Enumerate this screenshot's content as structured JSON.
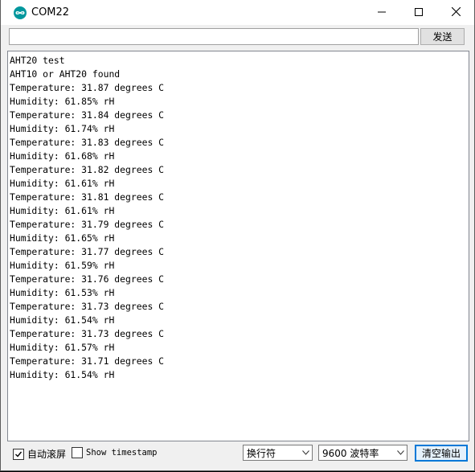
{
  "window": {
    "title": "COM22",
    "icon": "arduino-logo-icon",
    "controls": [
      "minimize-icon",
      "maximize-icon",
      "close-icon"
    ]
  },
  "send": {
    "input_value": "",
    "button_label": "发送"
  },
  "output": {
    "lines": [
      "AHT20 test",
      "AHT10 or AHT20 found",
      "Temperature: 31.87 degrees C",
      "Humidity: 61.85% rH",
      "Temperature: 31.84 degrees C",
      "Humidity: 61.74% rH",
      "Temperature: 31.83 degrees C",
      "Humidity: 61.68% rH",
      "Temperature: 31.82 degrees C",
      "Humidity: 61.61% rH",
      "Temperature: 31.81 degrees C",
      "Humidity: 61.61% rH",
      "Temperature: 31.79 degrees C",
      "Humidity: 61.65% rH",
      "Temperature: 31.77 degrees C",
      "Humidity: 61.59% rH",
      "Temperature: 31.76 degrees C",
      "Humidity: 61.53% rH",
      "Temperature: 31.73 degrees C",
      "Humidity: 61.54% rH",
      "Temperature: 31.73 degrees C",
      "Humidity: 61.57% rH",
      "Temperature: 31.71 degrees C",
      "Humidity: 61.54% rH"
    ]
  },
  "footer": {
    "autoscroll_label": "自动滚屏",
    "autoscroll_checked": true,
    "timestamp_label": "Show timestamp",
    "timestamp_checked": false,
    "line_ending": "换行符",
    "baud_rate": "9600 波特率",
    "clear_label": "清空输出"
  },
  "colors": {
    "arduino_teal": "#00979d",
    "button_focus_border": "#0078d7",
    "button_focus_fill": "#e5f1fb"
  }
}
